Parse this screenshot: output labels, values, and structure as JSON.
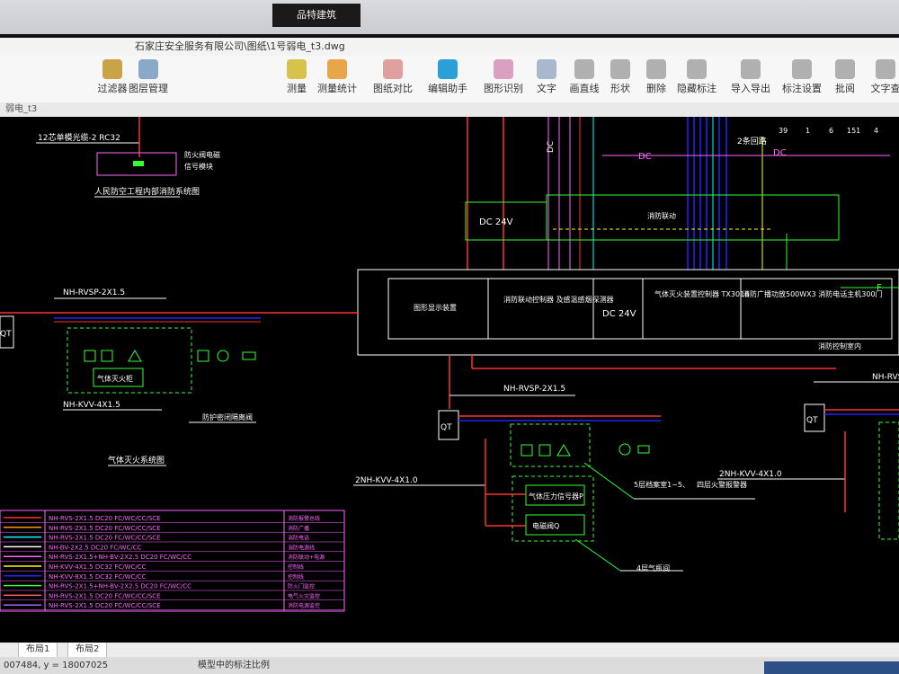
{
  "wall": {
    "sign": "品特建筑"
  },
  "title_bar": {
    "path": "石家庄安全服务有限公司\\图纸\\1号弱电_t3.dwg"
  },
  "toolbar": [
    {
      "label": "过滤器",
      "color": "#c9a34a"
    },
    {
      "label": "图层管理",
      "color": "#8aa9c9"
    },
    {
      "label": "测量",
      "color": "#d7c24b"
    },
    {
      "label": "测量统计",
      "color": "#e8a54a"
    },
    {
      "label": "图纸对比",
      "color": "#e0a0a0"
    },
    {
      "label": "编辑助手",
      "color": "#2aa0d8"
    },
    {
      "label": "图形识别",
      "color": "#d9a0c0"
    },
    {
      "label": "文字",
      "color": "#a9b8cf"
    },
    {
      "label": "画直线",
      "color": "#b0b0b0"
    },
    {
      "label": "形状",
      "color": "#b0b0b0"
    },
    {
      "label": "删除",
      "color": "#b0b0b0"
    },
    {
      "label": "隐藏标注",
      "color": "#b0b0b0"
    },
    {
      "label": "导入导出",
      "color": "#b0b0b0"
    },
    {
      "label": "标注设置",
      "color": "#b0b0b0"
    },
    {
      "label": "批阅",
      "color": "#b0b0b0"
    },
    {
      "label": "文字查",
      "color": "#b0b0b0"
    }
  ],
  "document_tab": {
    "label": "弱电_t3"
  },
  "drawing": {
    "header_labels": [
      "39",
      "1",
      "6",
      "151",
      "4"
    ],
    "top_left_note": "12芯单模光缆-2 RC32",
    "top_left_box_text": [
      "防火阀电磁",
      "信号模块"
    ],
    "top_left_title": "人民防空工程内部消防系统图",
    "dc_labels": [
      "DC",
      "DC",
      "DC"
    ],
    "fire_alarm": "2条回路",
    "power_box": "DC 24V",
    "link_box_label": "消防联动",
    "control_room": {
      "cells": [
        "图形显示装置",
        "消防联动控制器\n及感温感烟探测器",
        "DC 24V",
        "气体灭火装置控制器\nTX3016",
        "消防广播功放500WX3\n消防电话主机300门"
      ],
      "caption": "消防控制室内"
    },
    "cables": [
      "NH-RVSP-2X1.5",
      "NH-KVV-4X1.5",
      "NH-RVSP-2X1.5",
      "2NH-KVV-4X1.0",
      "2NH-KVV-4X1.0",
      "NH-RVS"
    ],
    "qt_label": "QT",
    "box_labels": [
      "气体灭火柜",
      "防护密闭隔离阀",
      "气体灭火系统图",
      "气体压力信号器P",
      "电磁阀Q",
      "5层档案室1~5、",
      "四层火警报警器",
      "4层气瓶间"
    ],
    "wire_f": "F",
    "legend": [
      {
        "spec": "NH-RVS-2X1.5 DC20 FC/WC/CC/SCE",
        "desc": "消防报警总线",
        "color": "#ff3030"
      },
      {
        "spec": "NH-RVS-2X1.5 DC20 FC/WC/CC/SCE",
        "desc": "消防广播",
        "color": "#ff9900"
      },
      {
        "spec": "NH-RVS-2X1.5 DC20 FC/WC/CC/SCE",
        "desc": "消防电话",
        "color": "#00ffff"
      },
      {
        "spec": "NH-BV-2X2.5 DC20 FC/WC/CC",
        "desc": "消防电源线",
        "color": "#ffffff"
      },
      {
        "spec": "NH-RVS-2X1.5+NH-BV-2X2.5 DC20 FC/WC/CC",
        "desc": "消防联动+电源",
        "color": "#ff66ff"
      },
      {
        "spec": "NH-KVV-4X1.5 DC32 FC/WC/CC",
        "desc": "控制线",
        "color": "#ffff00"
      },
      {
        "spec": "NH-KVV-8X1.5 DC32 FC/WC/CC",
        "desc": "控制线",
        "color": "#2222ff"
      },
      {
        "spec": "NH-RVS-2X1.5+NH-BV-2X2.5 DC20 FC/WC/CC",
        "desc": "防火门监控",
        "color": "#33ff33"
      },
      {
        "spec": "NH-RVS-2X1.5 DC20 FC/WC/CC/SCE",
        "desc": "电气火灾监控",
        "color": "#ff6666"
      },
      {
        "spec": "NH-RVS-2X1.5 DC20 FC/WC/CC/SCE",
        "desc": "消防电源监控",
        "color": "#aa66ff"
      }
    ]
  },
  "layout_tabs": [
    "布局1",
    "布局2"
  ],
  "status": {
    "coords": "007484, y = 18007025",
    "mode": "模型中的标注比例"
  }
}
